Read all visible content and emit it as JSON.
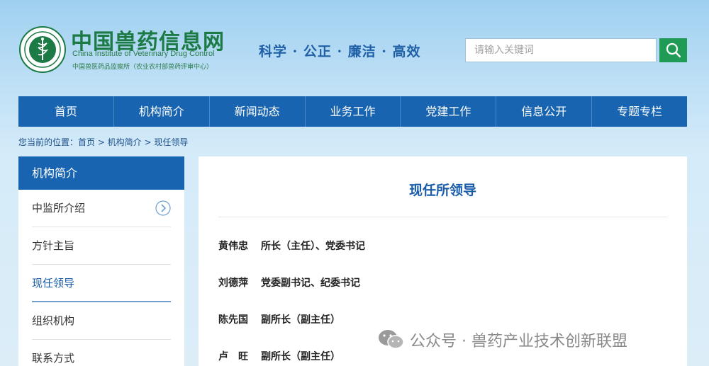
{
  "header": {
    "logo_cn": "中国兽药信息网",
    "logo_en": "China Institute of Veterinary Drug Control",
    "logo_sub": "中国兽医药品监察所（农业农村部兽药评审中心）",
    "slogan": "科学 · 公正 · 廉洁 · 高效",
    "search_placeholder": "请输入关键词",
    "search_icon": "magnifier-icon"
  },
  "nav": {
    "items": [
      "首页",
      "机构简介",
      "新闻动态",
      "业务工作",
      "党建工作",
      "信息公开",
      "专题专栏"
    ]
  },
  "breadcrumb": "您当前的位置：首页 > 机构简介 > 现任领导",
  "sidebar": {
    "title": "机构简介",
    "items": [
      {
        "label": "中监所介绍"
      },
      {
        "label": "方针主旨"
      },
      {
        "label": "现任领导"
      },
      {
        "label": "组织机构"
      },
      {
        "label": "联系方式"
      }
    ],
    "active_index": 2
  },
  "main": {
    "title": "现任所领导",
    "leaders": [
      {
        "name": "黄伟忠",
        "role": "所长（主任）、党委书记"
      },
      {
        "name": "刘德萍",
        "role": "党委副书记、纪委书记"
      },
      {
        "name": "陈先国",
        "role": "副所长（副主任）"
      },
      {
        "name": "卢　旺",
        "role": "副所长（副主任）"
      }
    ]
  },
  "watermark": {
    "text": "公众号 · 兽药产业技术创新联盟",
    "icon": "wechat-icon"
  },
  "colors": {
    "nav_blue": "#1864b0",
    "brand_green": "#1c7a44",
    "search_green": "#1f9b55",
    "title_blue": "#1a5ca8"
  }
}
